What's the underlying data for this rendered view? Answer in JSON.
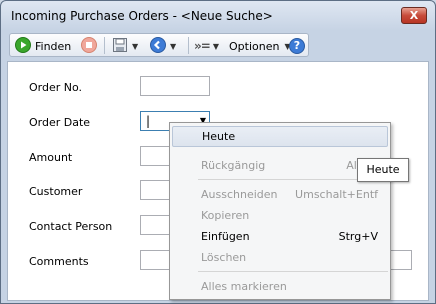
{
  "window": {
    "title": "Incoming Purchase Orders - <Neue Suche>",
    "close_glyph": "X"
  },
  "toolbar": {
    "find_label": "Finden",
    "options_label": "Optionen",
    "help_glyph": "?"
  },
  "form": {
    "fields": [
      {
        "label": "Order No."
      },
      {
        "label": "Order Date",
        "value": "|"
      },
      {
        "label": "Amount"
      },
      {
        "label": "Customer"
      },
      {
        "label": "Contact Person"
      },
      {
        "label": "Comments"
      }
    ]
  },
  "context_menu": {
    "items": [
      {
        "label": "Heute",
        "shortcut": "",
        "enabled": true
      },
      {
        "label": "Rückgängig",
        "shortcut": "Alt+R",
        "enabled": false
      },
      {
        "label": "Ausschneiden",
        "shortcut": "Umschalt+Entf",
        "enabled": false
      },
      {
        "label": "Kopieren",
        "shortcut": "",
        "enabled": false
      },
      {
        "label": "Einfügen",
        "shortcut": "Strg+V",
        "enabled": true
      },
      {
        "label": "Löschen",
        "shortcut": "",
        "enabled": false
      },
      {
        "label": "Alles markieren",
        "shortcut": "",
        "enabled": false
      }
    ]
  },
  "tooltip": {
    "text": "Heute"
  },
  "colors": {
    "accent": "#4a6fa5",
    "find_green": "#3aa62c",
    "stop_red": "#e0533e",
    "help_blue": "#3d7bd6"
  }
}
